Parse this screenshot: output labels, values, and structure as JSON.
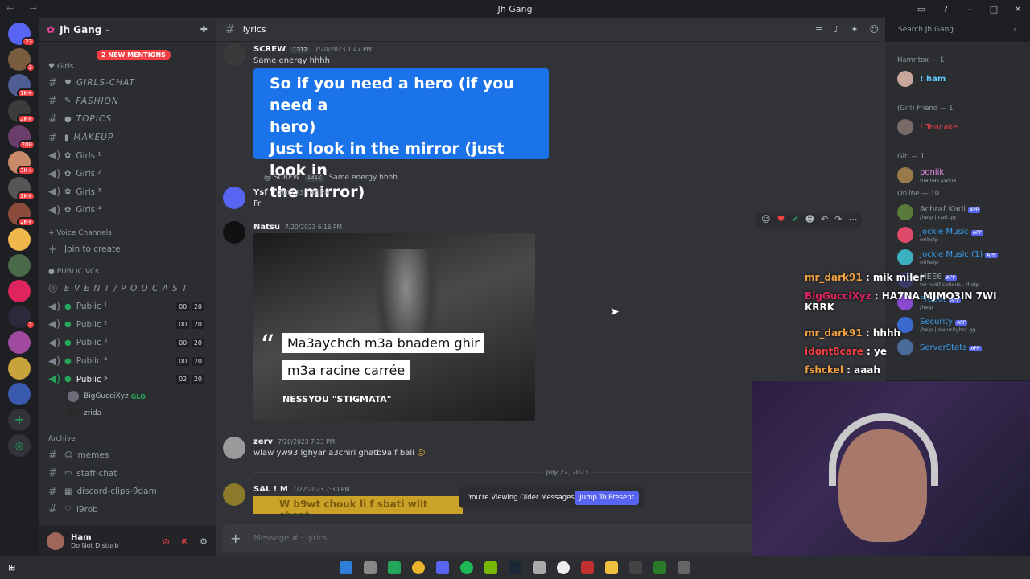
{
  "window": {
    "title": "Jh Gang",
    "nav": "← →"
  },
  "server": {
    "name": "Jh Gang",
    "mentions": "2 NEW MENTIONS"
  },
  "guild_badges": [
    "23",
    "3",
    "1K+",
    "2K+",
    "208",
    "3K+",
    "2K+",
    "2K+",
    "2"
  ],
  "categories": {
    "girls": "Girls",
    "voice": "Voice Channels",
    "public": "PUBLIC VCs",
    "archive": "Archive"
  },
  "girls_channels": [
    {
      "name": "GIRLS-CHAT"
    },
    {
      "name": "FASHION"
    },
    {
      "name": "TOPICS"
    },
    {
      "name": "MAKEUP"
    }
  ],
  "girls_voice": [
    "Girls ¹",
    "Girls ²",
    "Girls ³",
    "Girls ⁴"
  ],
  "voice_join": "Join to create",
  "event_channel": "E V E N T / P O D C A S T",
  "public_vcs": [
    {
      "name": "Public ¹",
      "a": "00",
      "b": "20"
    },
    {
      "name": "Public ²",
      "a": "00",
      "b": "20"
    },
    {
      "name": "Public ³",
      "a": "00",
      "b": "20"
    },
    {
      "name": "Public ⁴",
      "a": "00",
      "b": "20"
    },
    {
      "name": "Public ⁵",
      "a": "02",
      "b": "20"
    }
  ],
  "voice_users": [
    "BigGucciXyz",
    "zrida"
  ],
  "voice_user_tag": "GLO",
  "archive_channels": [
    "memes",
    "staff-chat",
    "discord-clips-9dam",
    "l9rob"
  ],
  "user": {
    "name": "Ham",
    "status": "Do Not Disturb"
  },
  "channel": {
    "name": "lyrics",
    "composer_placeholder": "Message #  · lyrics"
  },
  "search_placeholder": "Search Jh Gang",
  "messages": {
    "m1": {
      "user": "SCREW",
      "tag": "1312",
      "time": "7/20/2023 1:47 PM",
      "text": "Same energy hhhh"
    },
    "card": {
      "line1": "So if you need a hero (if you need a",
      "line2": "hero)",
      "line3": "Just look in the mirror (just look in",
      "line4": "the mirror)"
    },
    "reply": {
      "user": "@ SCREW",
      "tag": "1312",
      "text": "Same energy hhhh"
    },
    "m2": {
      "user": "Ysf",
      "time": "7/20/2023 1:48 PM",
      "text": "Fr"
    },
    "m3": {
      "user": "Natsu",
      "time": "7/20/2023 6:16 PM"
    },
    "image": {
      "line1": "Ma3aychch m3a bnadem ghir",
      "line2": "m3a racine carrée",
      "author": "NESSYOU \"STIGMATA\""
    },
    "m4": {
      "user": "zerv",
      "time": "7/20/2023 7:23 PM",
      "text": "wlaw yw93 lghyar a3chiri ghatb9a f bali"
    },
    "m5": {
      "user": "SAL ! M",
      "time": "7/22/2023 7:30 PM",
      "text": "W b9wt chouk li f sbati wlit sbaat"
    }
  },
  "date_divider": "July 22, 2023",
  "older_banner": {
    "text": "You're Viewing Older Messages",
    "button": "Jump To Present"
  },
  "members": {
    "groups": [
      "Hamritox — 1",
      "(Girl) Friend — 1",
      "Girl — 1",
      "Online — 10"
    ],
    "ham": "! ham",
    "teacake": "! Teacake",
    "poniik": "poniik",
    "poniik_sub": "mamak zwina",
    "online": [
      {
        "name": "Achraf Kadi",
        "sub": "/help | carl.gg"
      },
      {
        "name": "Jockie Music",
        "sub": "m!help"
      },
      {
        "name": "Jockie Music (1)",
        "sub": "m!help"
      },
      {
        "name": "MEE6",
        "sub": "for notifications.. /help"
      },
      {
        "name": "ProBot",
        "sub": "/help"
      },
      {
        "name": "Security",
        "sub": "/help | securitybot.gg"
      },
      {
        "name": "ServerStats",
        "sub": ""
      }
    ],
    "app_label": "APP"
  },
  "chat_overlay": [
    {
      "user": "mr_dark91",
      "text": ": mik miler"
    },
    {
      "user": "BigGucciXyz",
      "text": ": HA7NA MJMO3IN 7WI KRRK"
    },
    {
      "user": "mr_dark91",
      "text": ": hhhh"
    },
    {
      "user": "idont8care",
      "text": ": ye"
    },
    {
      "user": "fshckel",
      "text": ": aaah"
    }
  ],
  "colors": {
    "accent": "#5865f2",
    "card": "#1a73e8",
    "alert": "#f23f43"
  }
}
